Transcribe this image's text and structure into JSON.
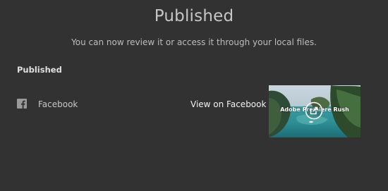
{
  "header": {
    "title": "Published",
    "subtitle": "You can now review it or access it through your local files."
  },
  "published_section": {
    "heading": "Published",
    "destinations": [
      {
        "platform": "Facebook",
        "icon": "facebook-icon",
        "view_link": "View on Facebook",
        "thumbnail_caption": "Adobe Premiere Rush"
      }
    ]
  },
  "colors": {
    "background": "#323232",
    "title": "#c6c6c6",
    "text": "#c8c8c8",
    "link": "#f2f2f2"
  }
}
